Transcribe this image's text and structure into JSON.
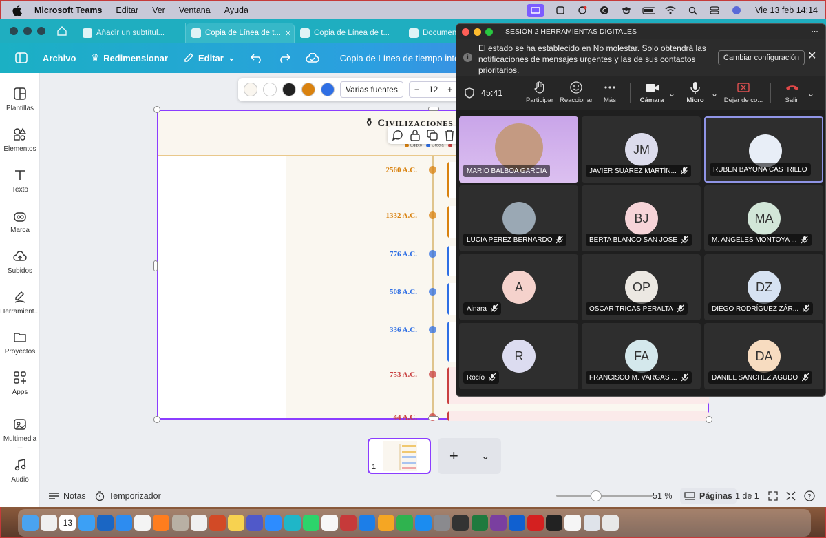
{
  "menubar": {
    "app": "Microsoft Teams",
    "items": [
      "Editar",
      "Ver",
      "Ventana",
      "Ayuda"
    ],
    "clock": "Vie 13 feb 14:14"
  },
  "browser": {
    "tabs": [
      {
        "label": "Añadir un subtítul..."
      },
      {
        "label": "Copia de Línea de t..."
      },
      {
        "label": "Copia de Línea de t..."
      },
      {
        "label": "Document"
      }
    ]
  },
  "canva_toolbar": {
    "archivo": "Archivo",
    "redimensionar": "Redimensionar",
    "editar": "Editar",
    "doc_title": "Copia de Línea de tiempo intera"
  },
  "sidebar": {
    "items": [
      {
        "label": "Plantillas"
      },
      {
        "label": "Elementos"
      },
      {
        "label": "Texto"
      },
      {
        "label": "Marca"
      },
      {
        "label": "Subidos"
      },
      {
        "label": "Herramient..."
      },
      {
        "label": "Proyectos"
      },
      {
        "label": "Apps"
      },
      {
        "label": "Multimedia ..."
      },
      {
        "label": "Audio"
      }
    ]
  },
  "format_bar": {
    "font": "Varias fuentes",
    "size": "12",
    "colors": [
      "#faf6ef",
      "#ffffff",
      "#222222",
      "#d9820f",
      "#2f6fe4"
    ]
  },
  "timeline": {
    "title": "Civilizaciones",
    "legend": [
      {
        "label": "Egipto",
        "color": "#d9820f"
      },
      {
        "label": "Grecia",
        "color": "#2f6fe4"
      },
      {
        "label": "",
        "color": "#c94040"
      }
    ],
    "events": [
      {
        "date": "2560 A.C.",
        "color": "#d9820f"
      },
      {
        "date": "1332 A.C.",
        "color": "#d9820f"
      },
      {
        "date": "776 A.C.",
        "color": "#2f6fe4"
      },
      {
        "date": "508 A.C.",
        "color": "#2f6fe4"
      },
      {
        "date": "336 A.C.",
        "color": "#2f6fe4"
      },
      {
        "date": "753 A.C.",
        "color": "#c94040"
      },
      {
        "date": "44 A.C.",
        "color": "#c94040"
      }
    ]
  },
  "pages": {
    "thumb_number": "1",
    "zoom": "51 %",
    "pages_label": "Páginas",
    "page_count": "1 de 1",
    "notes": "Notas",
    "timer": "Temporizador"
  },
  "teams": {
    "window_title": "SESIÓN 2 HERRAMIENTAS DIGITALES",
    "banner_text": "El estado se ha establecido en No molestar. Solo obtendrá las notificaciones de mensajes urgentes y las de sus contactos prioritarios.",
    "banner_button": "Cambiar configuración",
    "timer": "45:41",
    "controls": {
      "participar": "Participar",
      "reaccionar": "Reaccionar",
      "mas": "Más",
      "camara": "Cámara",
      "micro": "Micro",
      "dejar": "Dejar de co...",
      "salir": "Salir"
    },
    "participants": [
      {
        "name": "MARIO BALBOA GARCIA",
        "initials": "",
        "color": "#c8a3e8",
        "muted": false
      },
      {
        "name": "JAVIER SUÁREZ MARTÍN...",
        "initials": "JM",
        "color": "#dcdcec",
        "muted": true
      },
      {
        "name": "RUBEN BAYONA CASTRILLO",
        "initials": "",
        "color": "#e8eef7",
        "muted": false
      },
      {
        "name": "LUCIA PEREZ BERNARDO",
        "initials": "",
        "color": "#9aa8b4",
        "muted": true
      },
      {
        "name": "BERTA BLANCO SAN JOSÉ",
        "initials": "BJ",
        "color": "#f6d4d8",
        "muted": true
      },
      {
        "name": "M. ANGELES MONTOYA ...",
        "initials": "MA",
        "color": "#d2e6d8",
        "muted": true
      },
      {
        "name": "Ainara",
        "initials": "A",
        "color": "#f5d2cc",
        "muted": true
      },
      {
        "name": "OSCAR TRICAS PERALTA",
        "initials": "OP",
        "color": "#ece8e2",
        "muted": true
      },
      {
        "name": "DIEGO RODRÍGUEZ ZÁR...",
        "initials": "DZ",
        "color": "#d6e2f2",
        "muted": true
      },
      {
        "name": "Rocío",
        "initials": "R",
        "color": "#dcdcf0",
        "muted": true
      },
      {
        "name": "FRANCISCO M. VARGAS ...",
        "initials": "FA",
        "color": "#d4e8ec",
        "muted": true
      },
      {
        "name": "DANIEL SANCHEZ AGUDO",
        "initials": "DA",
        "color": "#f7dcc0",
        "muted": true
      }
    ]
  },
  "dock": {
    "calendar_day": "13",
    "apps": [
      "finder-icon",
      "launchpad-icon",
      "calendar-icon",
      "mail-icon",
      "outlook-icon",
      "safari-icon",
      "chrome-icon",
      "firefox-icon",
      "contacts-icon",
      "photos-icon",
      "powerpoint-icon",
      "notes-icon",
      "teams-icon",
      "zoom-icon",
      "canva-icon",
      "whatsapp-icon",
      "photos2-icon",
      "dictionary-icon",
      "keynote-icon",
      "pages-icon",
      "numbers-icon",
      "appstore-icon",
      "settings-icon",
      "screenshot-icon",
      "excel-icon",
      "winrar-icon",
      "app-icon",
      "acrobat-icon",
      "terminal-icon",
      "preview-icon",
      "finder-window-icon",
      "trash-icon"
    ]
  }
}
